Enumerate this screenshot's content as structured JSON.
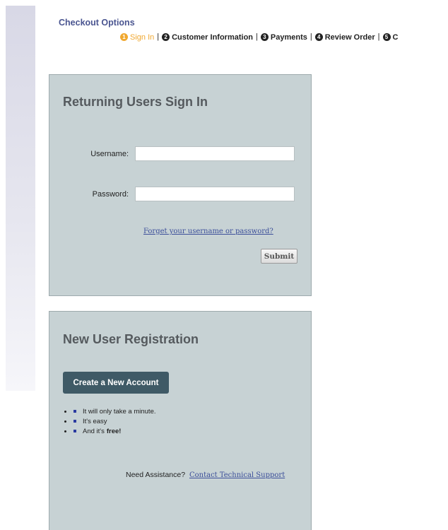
{
  "page": {
    "title": "Checkout Options"
  },
  "steps": [
    {
      "num": "1",
      "label": "Sign In",
      "active": true
    },
    {
      "num": "2",
      "label": "Customer Information"
    },
    {
      "num": "3",
      "label": "Payments"
    },
    {
      "num": "4",
      "label": "Review Order"
    },
    {
      "num": "5",
      "label": "C"
    }
  ],
  "signin": {
    "title": "Returning Users Sign In",
    "username_label": "Username:",
    "username_value": "",
    "password_label": "Password:",
    "password_value": "",
    "forgot_link": "Forget your username or password?",
    "submit_label": "Submit"
  },
  "register": {
    "title": "New User Registration",
    "create_button": "Create a New Account",
    "bullets": [
      {
        "text": "It will only take a minute."
      },
      {
        "text": "It's easy"
      },
      {
        "text": "And it's",
        "bold": "free!"
      }
    ],
    "assist_text": "Need Assistance?",
    "assist_link": "Contact Technical Support"
  },
  "colors": {
    "panel_bg": "#c7d2d4",
    "accent_link": "#3c4f9a",
    "active_step": "#f0a830",
    "button_dark": "#3f5a66"
  }
}
